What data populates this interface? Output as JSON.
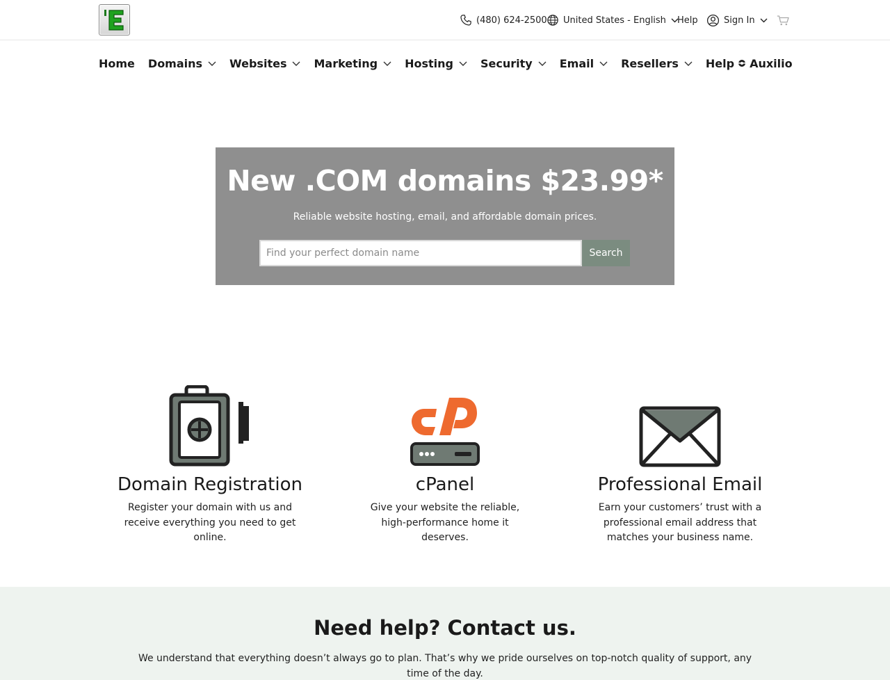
{
  "header": {
    "logo_alt": "E",
    "phone": "(480) 624-2500",
    "locale": "United States - English",
    "help": "Help",
    "sign_in": "Sign In"
  },
  "nav": {
    "items": [
      {
        "label": "Home"
      },
      {
        "label": "Domains"
      },
      {
        "label": "Websites"
      },
      {
        "label": "Marketing"
      },
      {
        "label": "Hosting"
      },
      {
        "label": "Security"
      },
      {
        "label": "Email"
      },
      {
        "label": "Resellers"
      }
    ],
    "help_label": "Help",
    "help_suffix": "Auxilio"
  },
  "hero": {
    "title": "New .COM domains $23.99*",
    "subtitle": "Reliable website hosting, email, and affordable domain prices.",
    "search_placeholder": "Find your perfect domain name",
    "search_button": "Search"
  },
  "features": [
    {
      "icon": "domain-registration-icon",
      "title": "Domain Registration",
      "text": "Register your domain with us and receive everything you need to get online."
    },
    {
      "icon": "cpanel-icon",
      "title": "cPanel",
      "text": "Give your website the reliable, high-performance home it deserves."
    },
    {
      "icon": "envelope-icon",
      "title": "Professional Email",
      "text": "Earn your customers’ trust with a professional email address that matches your business name."
    }
  ],
  "contact": {
    "title": "Need help? Contact us.",
    "text": "We understand that everything doesn’t always go to plan. That’s why we pride ourselves on top-notch quality of support, any time of the day."
  },
  "colors": {
    "hero_bg": "#8f8f8f",
    "search_button_bg": "#7b8c80",
    "cpanel_orange": "#ee6a2f",
    "icon_gray": "#6f7a73",
    "contact_bg": "#eef3ef"
  }
}
